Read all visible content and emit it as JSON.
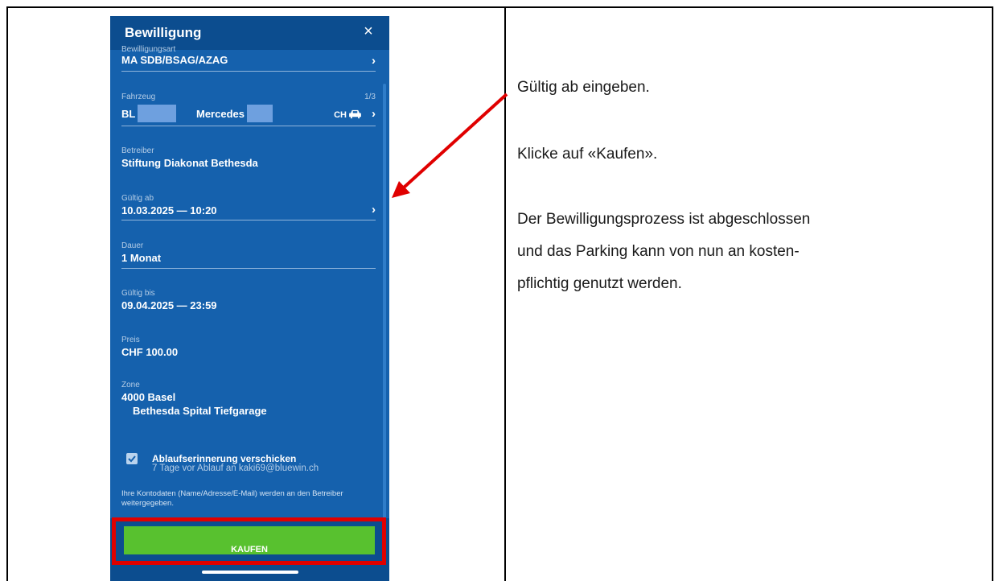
{
  "dialog": {
    "title": "Bewilligung",
    "close_glyph": "×"
  },
  "fields": {
    "type_label": "Bewilligungsart",
    "type_value": "MA SDB/BSAG/AZAG",
    "vehicle_label": "Fahrzeug",
    "vehicle_counter": "1/3",
    "vehicle_plate": "BL",
    "vehicle_make": "Mercedes",
    "vehicle_country": "CH",
    "operator_label": "Betreiber",
    "operator_value": "Stiftung Diakonat Bethesda",
    "valid_from_label": "Gültig ab",
    "valid_from_value": "10.03.2025 — 10:20",
    "duration_label": "Dauer",
    "duration_value": "1 Monat",
    "valid_until_label": "Gültig bis",
    "valid_until_value": "09.04.2025 — 23:59",
    "price_label": "Preis",
    "price_value": "CHF 100.00",
    "zone_label": "Zone",
    "zone_value": "4000 Basel",
    "zone_detail": "Bethesda Spital Tiefgarage"
  },
  "reminder": {
    "checked": true,
    "title": "Ablaufserinnerung verschicken",
    "subtitle": "7 Tage vor Ablauf an kaki69@bluewin.ch"
  },
  "disclaimer": "Ihre Kontodaten (Name/Adresse/E-Mail) werden an den Betreiber weitergegeben.",
  "buy_button": "KAUFEN",
  "instructions": {
    "step1": "Gültig ab eingeben.",
    "step2": "Klicke auf «Kaufen».",
    "step3_line1": "Der Bewilligungsprozess ist abgeschlossen",
    "step3_line2": "und das Parking kann von nun an kosten-",
    "step3_line3": "pflichtig genutzt werden."
  },
  "colors": {
    "phone_bg": "#1561ad",
    "header_bg": "#0c4d8f",
    "buy_green": "#58c12f",
    "highlight_red": "#e00000"
  },
  "icons": [
    "close-icon",
    "chevron-right-icon",
    "car-icon",
    "checkmark-icon",
    "arrow-annotation"
  ]
}
